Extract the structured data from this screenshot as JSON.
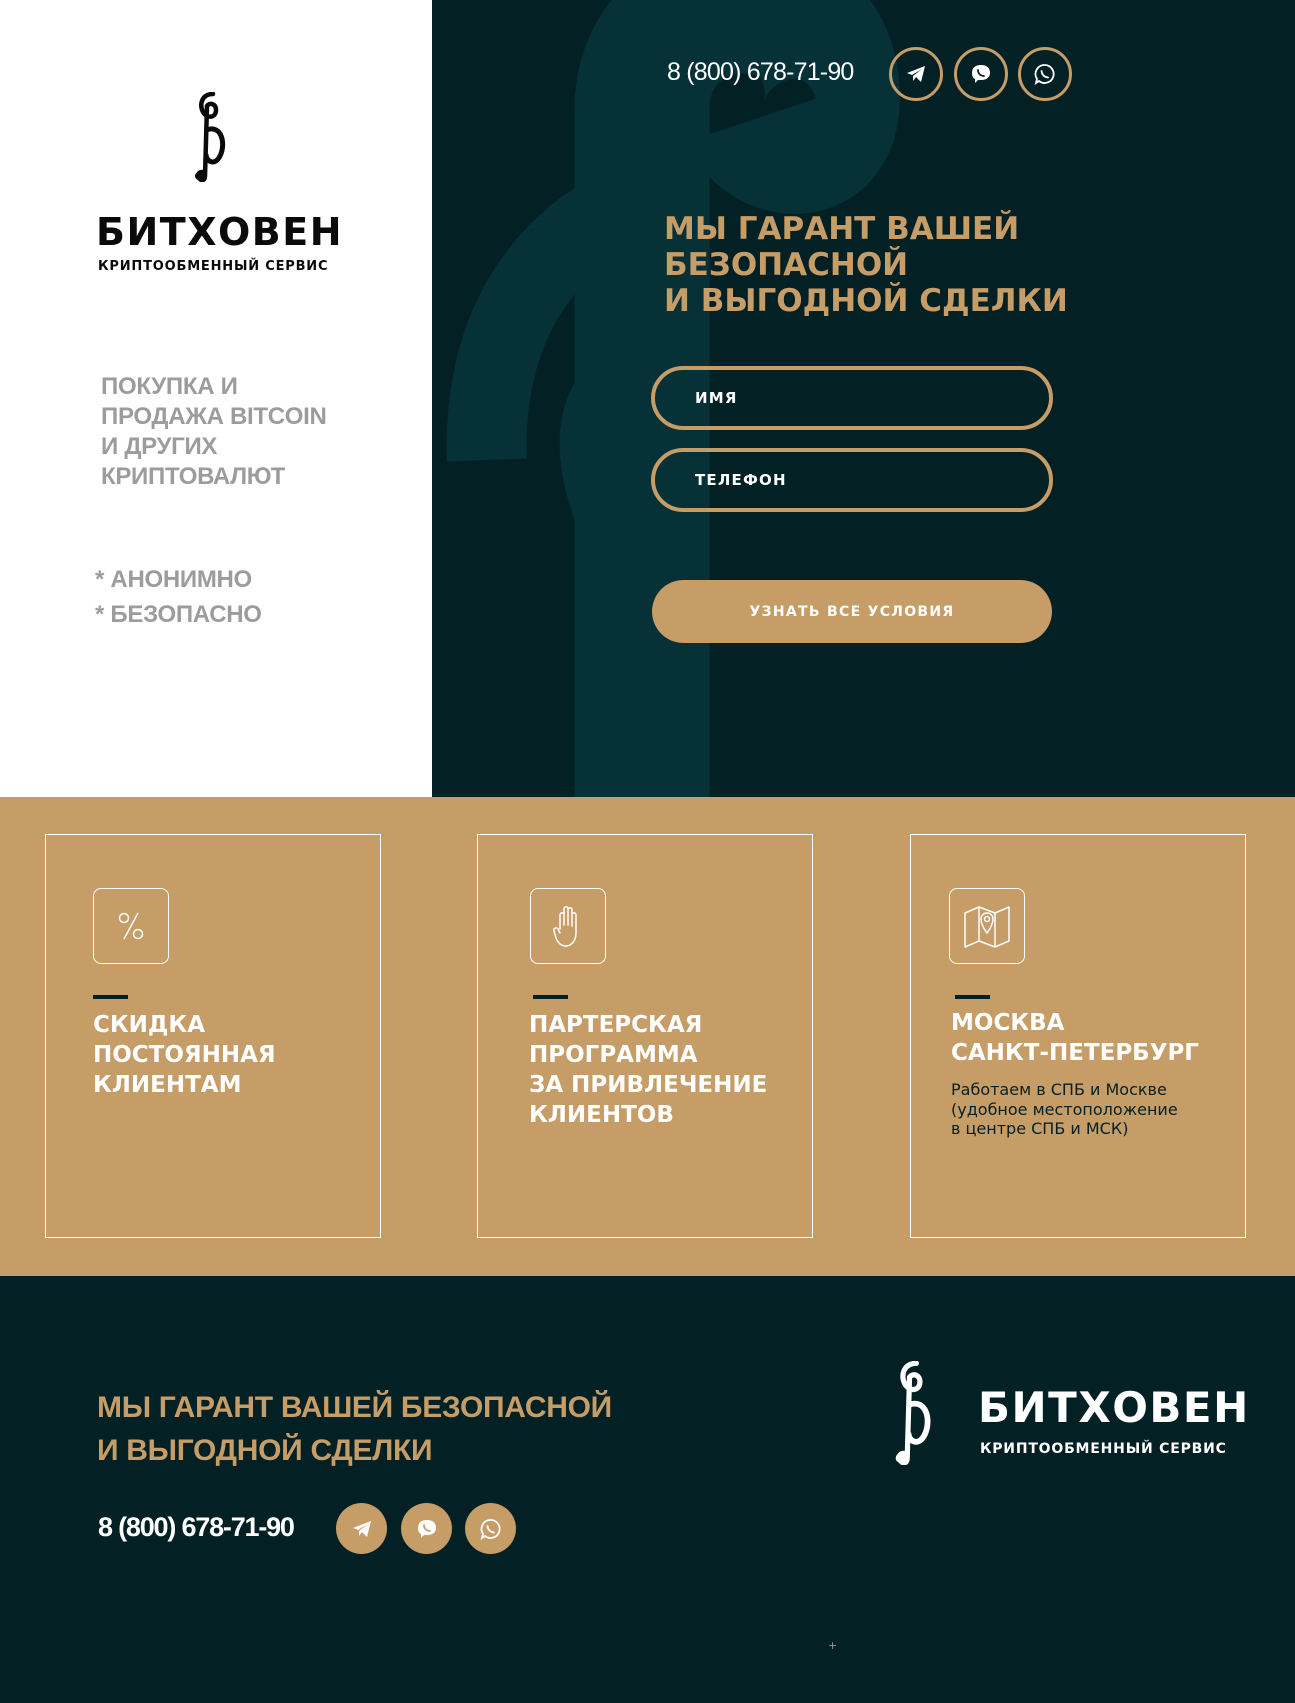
{
  "colors": {
    "dark_teal": "#032124",
    "gold": "#c69c67",
    "white": "#ffffff",
    "gray_text": "#9c9c9c"
  },
  "brand": {
    "name": "БИТХОВЕН",
    "subtitle": "КРИПТООБМЕННЫЙ СЕРВИС",
    "logo_icon": "treble-clef-b-icon"
  },
  "hero": {
    "tagline_lines": [
      "ПОКУПКА И",
      "ПРОДАЖА BITCOIN",
      "И ДРУГИХ",
      "КРИПТОВАЛЮТ"
    ],
    "features": [
      "* АНОНИМНО",
      "* БЕЗОПАСНО"
    ],
    "phone": "8 (800) 678-71-90",
    "messengers": [
      {
        "name": "Telegram",
        "icon": "telegram-icon"
      },
      {
        "name": "Viber",
        "icon": "viber-icon"
      },
      {
        "name": "WhatsApp",
        "icon": "whatsapp-icon"
      }
    ],
    "heading_lines": [
      "МЫ ГАРАНТ ВАШЕЙ",
      "БЕЗОПАСНОЙ",
      "И ВЫГОДНОЙ СДЕЛКИ"
    ]
  },
  "form": {
    "name_placeholder": "ИМЯ",
    "name_value": "",
    "phone_placeholder": "ТЕЛЕФОН",
    "phone_value": "",
    "submit_label": "УЗНАТЬ ВСЕ УСЛОВИЯ"
  },
  "cards": [
    {
      "icon": "percent-icon",
      "title_lines": [
        "СКИДКА",
        "ПОСТОЯННАЯ",
        "КЛИЕНТАМ"
      ],
      "description_lines": []
    },
    {
      "icon": "hand-icon",
      "title_lines": [
        "ПАРТЕРСКАЯ",
        "ПРОГРАММА",
        "ЗА ПРИВЛЕЧЕНИЕ",
        "КЛИЕНТОВ"
      ],
      "description_lines": []
    },
    {
      "icon": "map-pin-icon",
      "title_lines": [
        "МОСКВА",
        "САНКТ-ПЕТЕРБУРГ"
      ],
      "description_lines": [
        "Работаем в СПБ и Москве",
        "(удобное местоположение",
        "в центре СПБ и МСК)"
      ]
    }
  ],
  "footer": {
    "heading_lines": [
      "МЫ ГАРАНТ ВАШЕЙ БЕЗОПАСНОЙ",
      "И ВЫГОДНОЙ СДЕЛКИ"
    ],
    "phone": "8 (800) 678-71-90",
    "brand_name": "БИТХОВЕН",
    "brand_subtitle": "КРИПТООБМЕННЫЙ СЕРВИС",
    "plus_mark": "+"
  }
}
